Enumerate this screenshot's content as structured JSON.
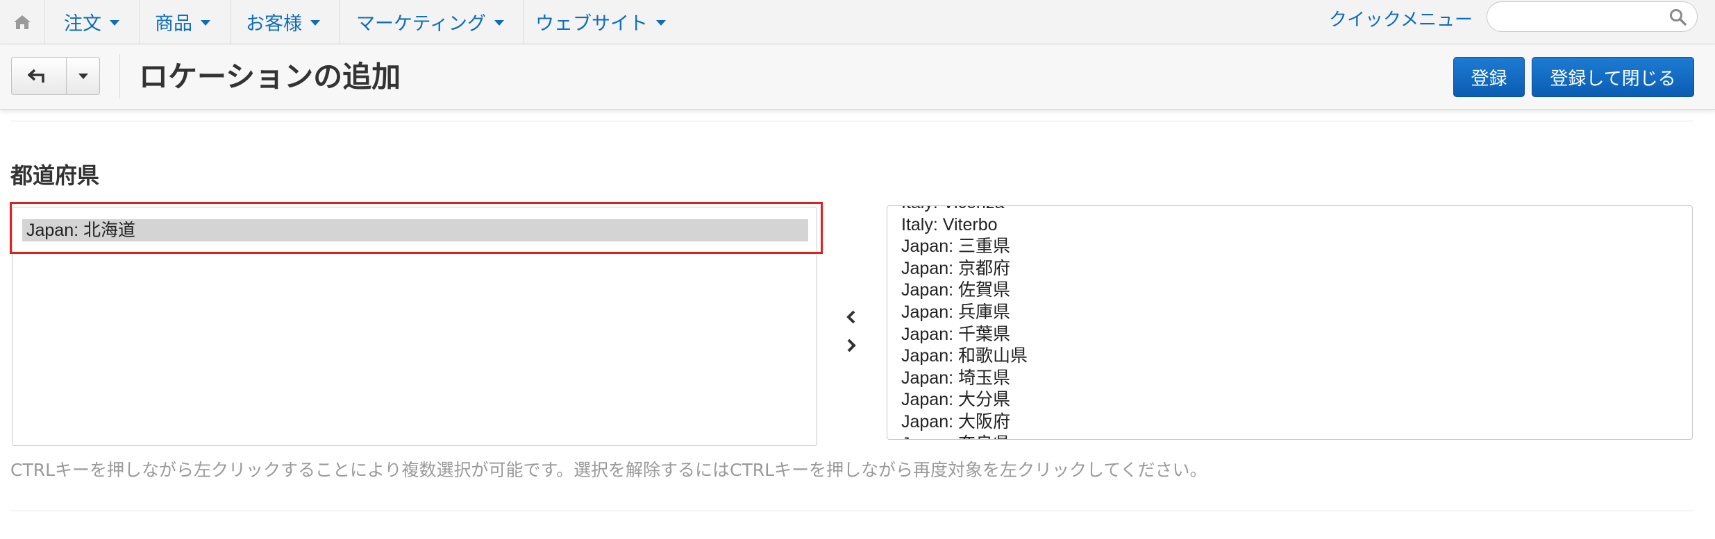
{
  "navbar": {
    "items": [
      {
        "label": "注文"
      },
      {
        "label": "商品"
      },
      {
        "label": "お客様"
      },
      {
        "label": "マーケティング"
      },
      {
        "label": "ウェブサイト"
      }
    ],
    "quick_menu": "クイックメニュー",
    "search_value": ""
  },
  "header": {
    "title": "ロケーションの追加",
    "save_label": "登録",
    "save_close_label": "登録して閉じる"
  },
  "section": {
    "label": "都道府県",
    "selected_items": [
      "Japan: 北海道"
    ],
    "available_items": [
      "Italy: Vicenza",
      "Italy: Viterbo",
      "Japan: 三重県",
      "Japan: 京都府",
      "Japan: 佐賀県",
      "Japan: 兵庫県",
      "Japan: 千葉県",
      "Japan: 和歌山県",
      "Japan: 埼玉県",
      "Japan: 大分県",
      "Japan: 大阪府",
      "Japan: 奈良県"
    ],
    "help_text": "CTRLキーを押しながら左クリックすることにより複数選択が可能です。選択を解除するにはCTRLキーを押しながら再度対象を左クリックしてください。"
  },
  "colors": {
    "link": "#0e6db8",
    "primary_button": "#0b62bd",
    "highlight_border": "#e0201a",
    "selected_option_bg": "#d4d4d4"
  }
}
